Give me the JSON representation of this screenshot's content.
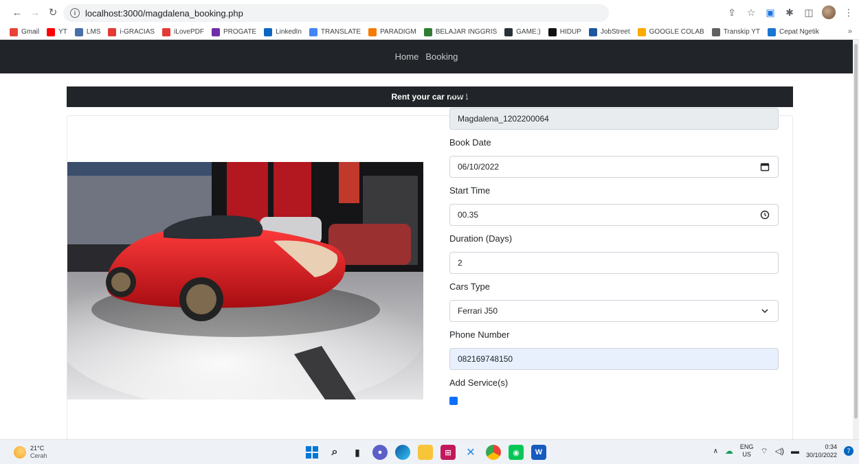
{
  "browser": {
    "url": "localhost:3000/magdalena_booking.php",
    "bookmarks": [
      {
        "label": "Gmail",
        "color": "#ea4335"
      },
      {
        "label": "YT",
        "color": "#ff0000"
      },
      {
        "label": "LMS",
        "color": "#4a6ea9"
      },
      {
        "label": "i-GRACIAS",
        "color": "#e53935"
      },
      {
        "label": "iLovePDF",
        "color": "#e53935"
      },
      {
        "label": "PROGATE",
        "color": "#6f2da8"
      },
      {
        "label": "LinkedIn",
        "color": "#0a66c2"
      },
      {
        "label": "TRANSLATE",
        "color": "#4285f4"
      },
      {
        "label": "PARADIGM",
        "color": "#f57c00"
      },
      {
        "label": "BELAJAR INGGRIS",
        "color": "#2e7d32"
      },
      {
        "label": "GAME:)",
        "color": "#263238"
      },
      {
        "label": "HIDUP",
        "color": "#111111"
      },
      {
        "label": "JobStreet",
        "color": "#1e56a0"
      },
      {
        "label": "GOOGLE COLAB",
        "color": "#f9ab00"
      },
      {
        "label": "Transkip YT",
        "color": "#616161"
      },
      {
        "label": "Cepat Ngetik",
        "color": "#1976d2"
      }
    ],
    "more": "»"
  },
  "nav": {
    "home": "Home",
    "booking": "Booking"
  },
  "banner": "Rent your car now !",
  "form": {
    "name_label": "Name",
    "name_value": "Magdalena_1202200064",
    "date_label": "Book Date",
    "date_value": "06/10/2022",
    "time_label": "Start Time",
    "time_value": "00.35",
    "duration_label": "Duration (Days)",
    "duration_value": "2",
    "car_label": "Cars Type",
    "car_value": "Ferrari J50",
    "phone_label": "Phone Number",
    "phone_value": "082169748150",
    "services_label": "Add Service(s)"
  },
  "taskbar": {
    "temp": "21°C",
    "weather": "Cerah",
    "lang1": "ENG",
    "lang2": "US",
    "time": "0:34",
    "date": "30/10/2022",
    "notifications": "7"
  },
  "colors": {
    "navbar": "#212529",
    "accent": "#0d6efd",
    "car_red": "#d8151c"
  }
}
